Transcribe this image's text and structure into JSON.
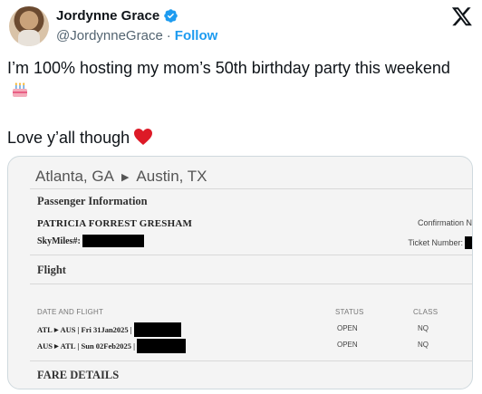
{
  "tweet": {
    "display_name": "Jordynne Grace",
    "handle": "@JordynneGrace",
    "dot": "·",
    "follow_label": "Follow",
    "line1": "I’m 100% hosting my mom’s 50th birthday party this weekend",
    "line2": "Love y’all though",
    "emoji1": "birthday-cake-icon",
    "emoji2": "red-heart-icon"
  },
  "ticket": {
    "origin": "Atlanta, GA",
    "destination": "Austin, TX",
    "passenger_section": "Passenger Information",
    "passenger_name": "PATRICIA FORREST GRESHAM",
    "skymiles_label": "SkyMiles#:",
    "confirmation_label": "Confirmation N",
    "ticket_number_label": "Ticket Number:",
    "flight_section": "Flight",
    "columns": {
      "date_and_flight": "DATE AND FLIGHT",
      "status": "STATUS",
      "class": "CLASS"
    },
    "flights": [
      {
        "route": "ATL",
        "to": "AUS",
        "date": "| Fri 31Jan2025 |",
        "status": "OPEN",
        "class": "NQ"
      },
      {
        "route": "AUS",
        "to": "ATL",
        "date": "| Sun 02Feb2025 |",
        "status": "OPEN",
        "class": "NQ"
      }
    ],
    "fare_section": "FARE DETAILS"
  },
  "colors": {
    "follow": "#1d9bf0",
    "verified": "#1d9bf0",
    "heart": "#e0245e"
  }
}
